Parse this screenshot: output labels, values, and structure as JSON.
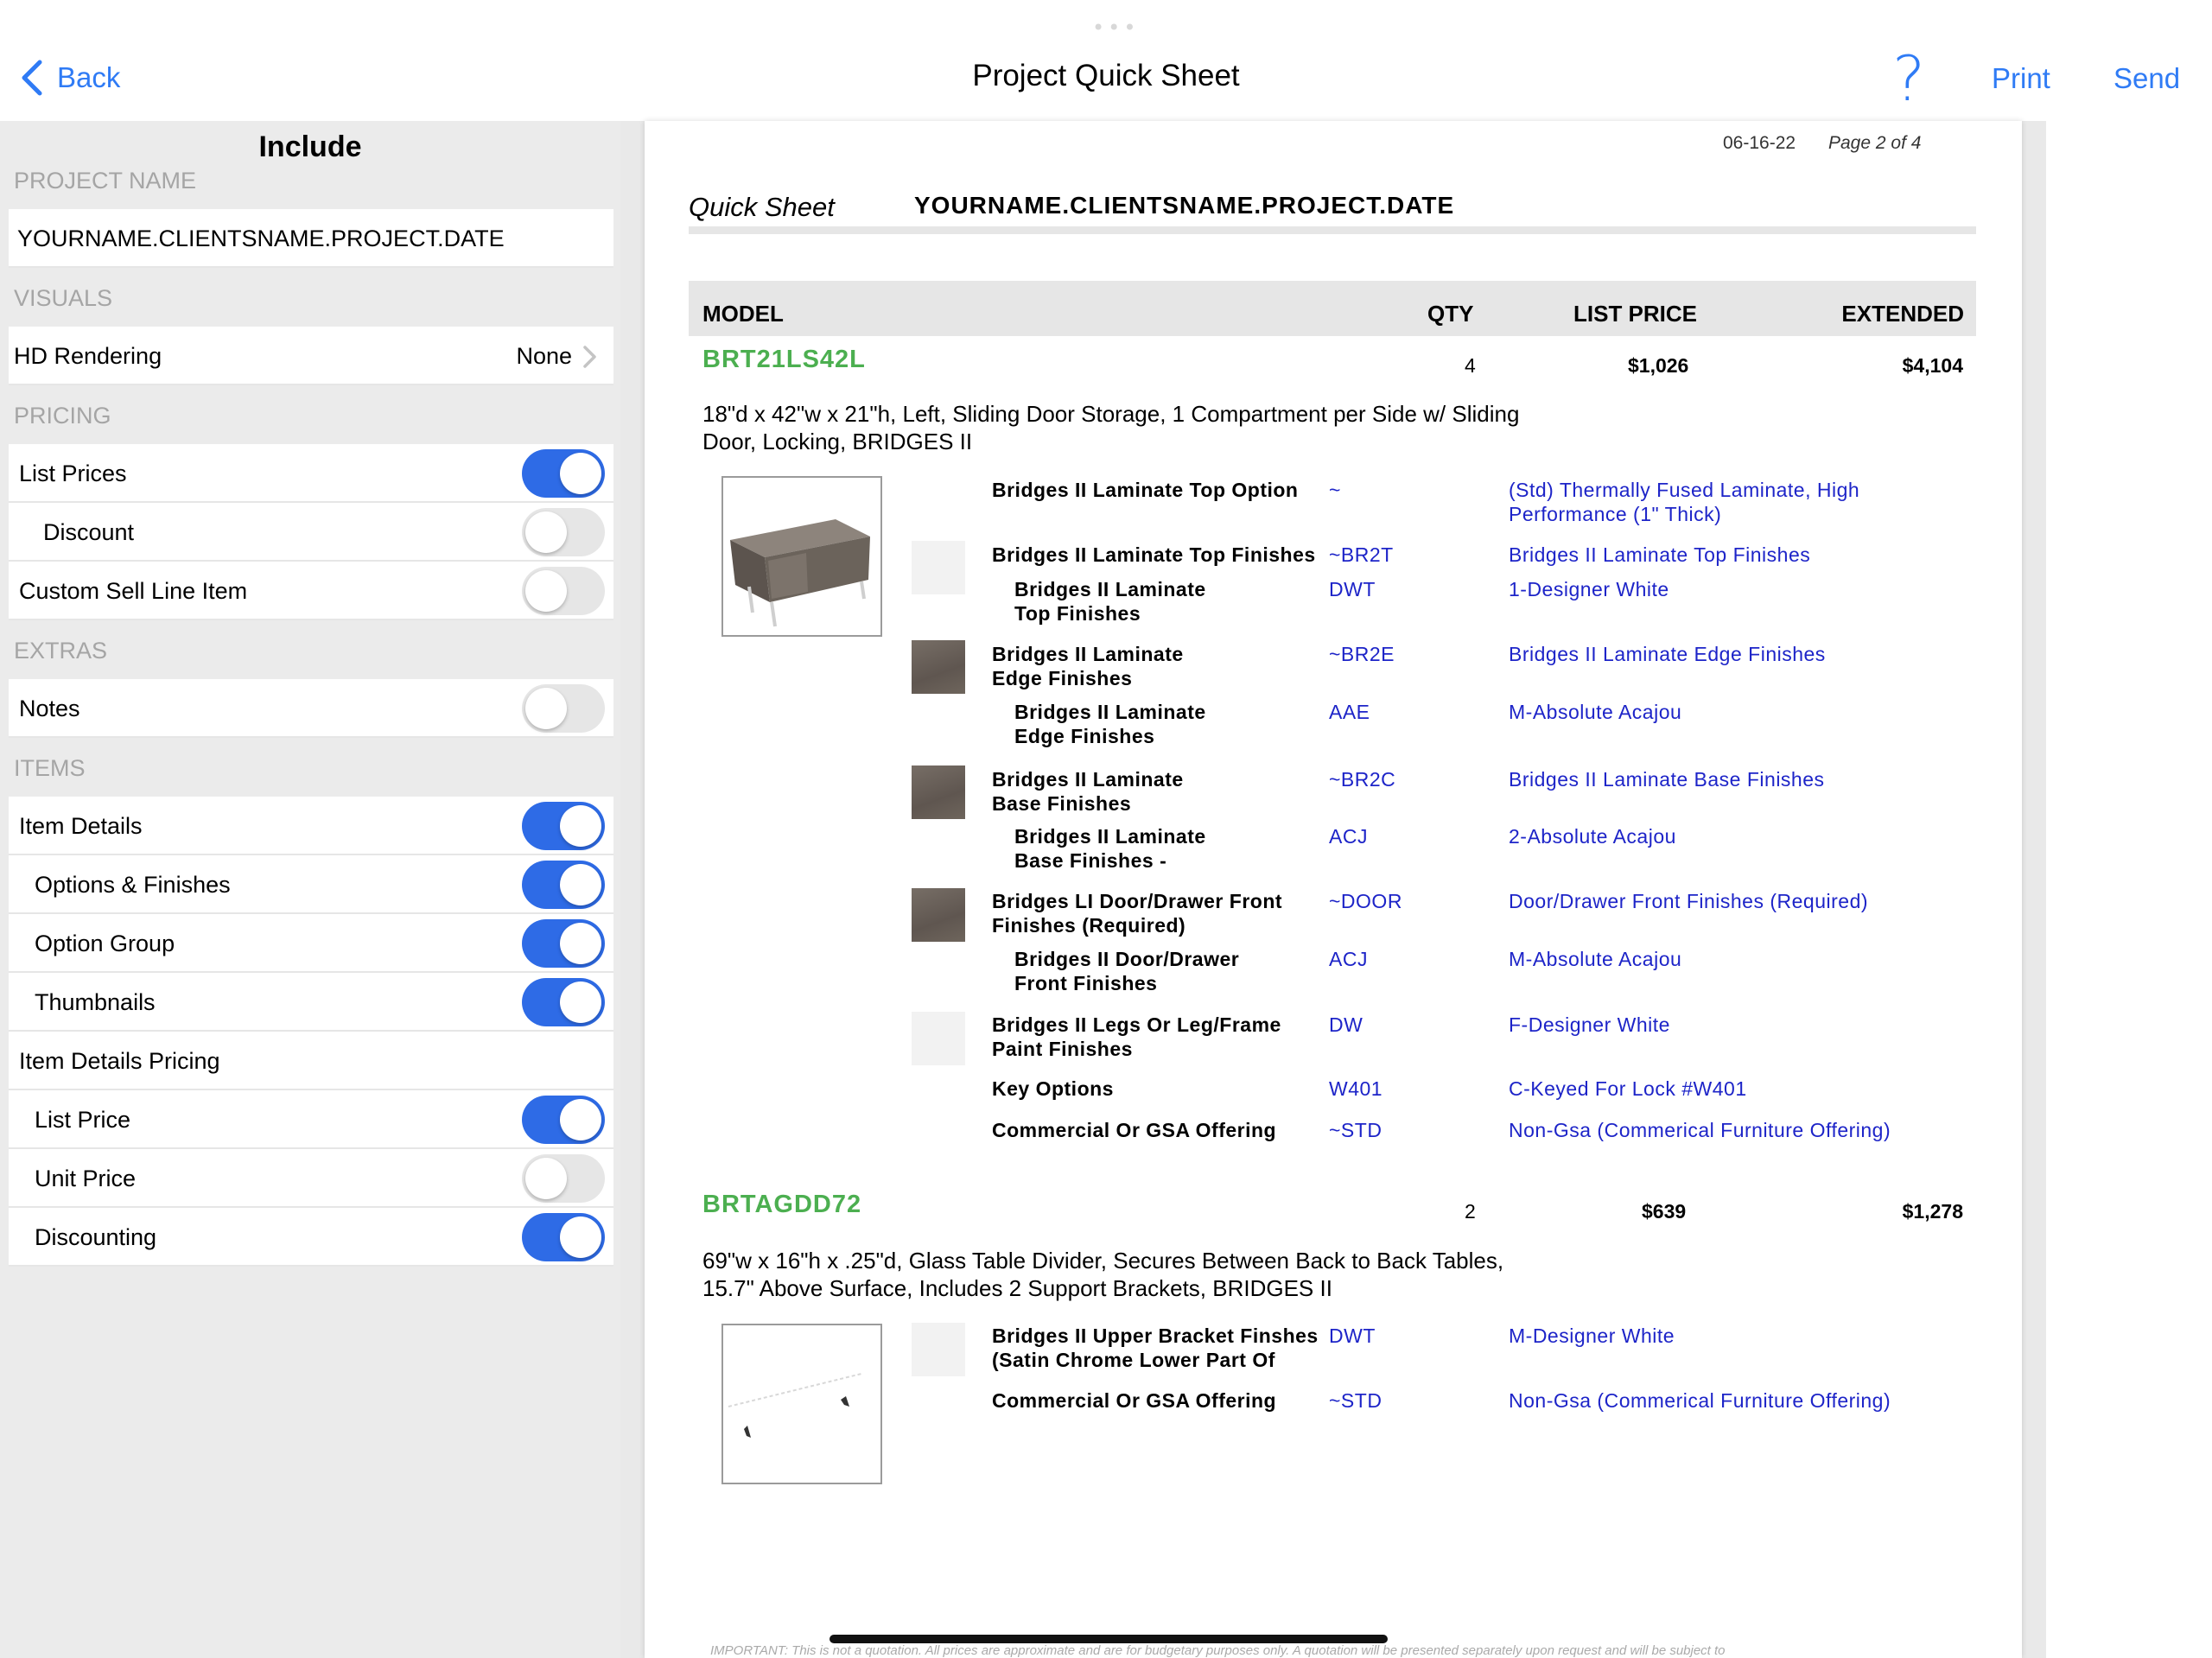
{
  "nav": {
    "back_label": "Back",
    "title": "Project Quick Sheet",
    "help_glyph": "?",
    "print_label": "Print",
    "send_label": "Send"
  },
  "panel": {
    "heading": "Include",
    "project_name_section": "PROJECT NAME",
    "project_name": "YOURNAME.CLIENTSNAME.PROJECT.DATE",
    "visuals_section": "VISUALS",
    "hd_rendering_label": "HD Rendering",
    "hd_rendering_value": "None",
    "pricing_section": "PRICING",
    "list_prices_label": "List Prices",
    "list_prices_on": true,
    "discount_label": "Discount",
    "discount_on": false,
    "custom_sell_label": "Custom Sell Line Item",
    "custom_sell_on": false,
    "extras_section": "EXTRAS",
    "notes_label": "Notes",
    "notes_on": false,
    "items_section": "ITEMS",
    "item_details_label": "Item Details",
    "item_details_on": true,
    "options_finishes_label": "Options & Finishes",
    "options_finishes_on": true,
    "option_group_label": "Option Group",
    "option_group_on": true,
    "thumbnails_label": "Thumbnails",
    "thumbnails_on": true,
    "item_details_pricing_label": "Item Details Pricing",
    "list_price_label": "List Price",
    "list_price_on": true,
    "unit_price_label": "Unit Price",
    "unit_price_on": false,
    "discounting_label": "Discounting",
    "discounting_on": true
  },
  "doc": {
    "date": "06-16-22",
    "page": "Page 2 of 4",
    "sheet_label": "Quick Sheet",
    "sheet_name": "YOURNAME.CLIENTSNAME.PROJECT.DATE",
    "headers": {
      "model": "MODEL",
      "qty": "QTY",
      "list_price": "LIST PRICE",
      "extended": "EXTENDED"
    },
    "items": [
      {
        "model": "BRT21LS42L",
        "qty": "4",
        "list_price": "$1,026",
        "extended": "$4,104",
        "desc_line1": "18\"d x 42\"w x 21\"h, Left, Sliding Door Storage, 1 Compartment per Side w/ Sliding",
        "desc_line2": "Door, Locking, BRIDGES II",
        "options": [
          {
            "name": [
              "Bridges II Laminate Top Option"
            ],
            "code": "~",
            "desc": [
              "(Std) Thermally Fused Laminate, High",
              "Performance (1\" Thick)"
            ]
          },
          {
            "name": [
              "Bridges II Laminate Top Finishes"
            ],
            "code": "~BR2T",
            "desc": [
              "Bridges II Laminate Top Finishes"
            ]
          },
          {
            "name": [
              "Bridges II Laminate",
              "Top Finishes"
            ],
            "code": "DWT",
            "desc": [
              "1-Designer White"
            ]
          },
          {
            "name": [
              "Bridges II Laminate",
              "Edge Finishes"
            ],
            "code": "~BR2E",
            "desc": [
              "Bridges II Laminate Edge Finishes"
            ]
          },
          {
            "name": [
              "Bridges II Laminate",
              "Edge Finishes"
            ],
            "code": "AAE",
            "desc": [
              "M-Absolute Acajou"
            ]
          },
          {
            "name": [
              "Bridges II Laminate",
              "Base Finishes"
            ],
            "code": "~BR2C",
            "desc": [
              "Bridges II Laminate Base Finishes"
            ]
          },
          {
            "name": [
              "Bridges II Laminate",
              "Base Finishes -"
            ],
            "code": "ACJ",
            "desc": [
              "2-Absolute Acajou"
            ]
          },
          {
            "name": [
              "Bridges LI Door/Drawer Front",
              "Finishes (Required)"
            ],
            "code": "~DOOR",
            "desc": [
              "Door/Drawer Front Finishes (Required)"
            ]
          },
          {
            "name": [
              "Bridges II Door/Drawer",
              "Front Finishes"
            ],
            "code": "ACJ",
            "desc": [
              "M-Absolute Acajou"
            ]
          },
          {
            "name": [
              "Bridges II Legs Or Leg/Frame",
              "Paint Finishes"
            ],
            "code": "DW",
            "desc": [
              "F-Designer White"
            ]
          },
          {
            "name": [
              "Key Options"
            ],
            "code": "W401",
            "desc": [
              "C-Keyed For Lock #W401"
            ]
          },
          {
            "name": [
              "Commercial Or GSA Offering"
            ],
            "code": "~STD",
            "desc": [
              "Non-Gsa (Commerical Furniture Offering)"
            ]
          }
        ]
      },
      {
        "model": "BRTAGDD72",
        "qty": "2",
        "list_price": "$639",
        "extended": "$1,278",
        "desc_line1": "69\"w x 16\"h x .25\"d, Glass Table Divider, Secures Between Back to Back Tables,",
        "desc_line2": "15.7\" Above Surface, Includes 2 Support Brackets, BRIDGES II",
        "options": [
          {
            "name": [
              "Bridges II Upper Bracket Finshes",
              "(Satin Chrome Lower Part Of"
            ],
            "code": "DWT",
            "desc": [
              "M-Designer White"
            ]
          },
          {
            "name": [
              "Commercial Or GSA Offering"
            ],
            "code": "~STD",
            "desc": [
              "Non-Gsa (Commerical Furniture Offering)"
            ]
          }
        ]
      }
    ],
    "footer": "IMPORTANT: This is not a quotation. All prices are approximate and are for budgetary purposes only. A quotation will be presented separately upon request and will be subject to"
  },
  "colors": {
    "accent": "#2f7bf5",
    "toggle_on": "#2e6be6",
    "model_green": "#4caf50",
    "option_blue": "#1d24c8"
  }
}
